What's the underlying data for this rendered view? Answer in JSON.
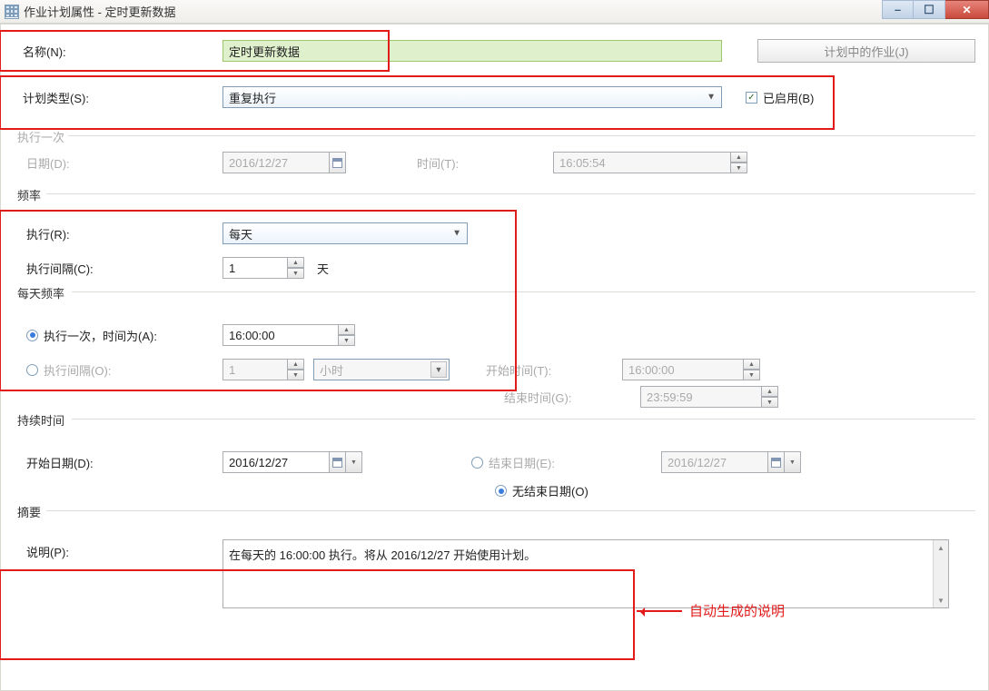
{
  "window": {
    "title": "作业计划属性 - 定时更新数据"
  },
  "topButtons": {
    "scheduledJob": "计划中的作业(J)"
  },
  "name": {
    "label": "名称(N):",
    "value": "定时更新数据"
  },
  "planType": {
    "label": "计划类型(S):",
    "value": "重复执行",
    "enableLabel": "已启用(B)"
  },
  "execOnce": {
    "legend": "执行一次",
    "dateLabel": "日期(D):",
    "dateValue": "2016/12/27",
    "timeLabel": "时间(T):",
    "timeValue": "16:05:54"
  },
  "frequency": {
    "legend": "频率",
    "execLabel": "执行(R):",
    "execValue": "每天",
    "intervalLabel": "执行间隔(C):",
    "intervalValue": "1",
    "intervalUnit": "天"
  },
  "daily": {
    "legend": "每天频率",
    "onceLabel": "执行一次，时间为(A):",
    "onceValue": "16:00:00",
    "intervalLabel": "执行间隔(O):",
    "intervalValue": "1",
    "intervalUnit": "小时",
    "startLabel": "开始时间(T):",
    "startValue": "16:00:00",
    "endLabel": "结束时间(G):",
    "endValue": "23:59:59"
  },
  "duration": {
    "legend": "持续时间",
    "startDateLabel": "开始日期(D):",
    "startDateValue": "2016/12/27",
    "endDateLabel": "结束日期(E):",
    "endDateValue": "2016/12/27",
    "noEndLabel": "无结束日期(O)"
  },
  "summary": {
    "legend": "摘要",
    "descLabel": "说明(P):",
    "descValue": "在每天的 16:00:00 执行。将从 2016/12/27 开始使用计划。"
  },
  "annotation": "自动生成的说明"
}
